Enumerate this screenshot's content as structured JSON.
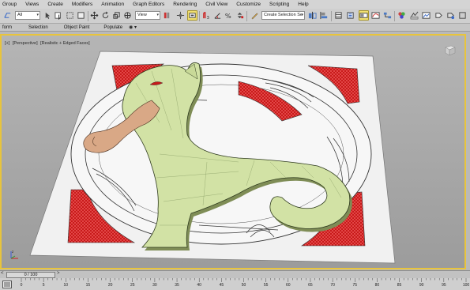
{
  "menubar": {
    "items": [
      "Group",
      "Views",
      "Create",
      "Modifiers",
      "Animation",
      "Graph Editors",
      "Rendering",
      "Civil View",
      "Customize",
      "Scripting",
      "Help"
    ]
  },
  "toolbar": {
    "selection_filter": "All",
    "reference_coord_system": "View",
    "named_selection_placeholder": "Create Selection Se",
    "icons": [
      "undo-icon",
      "selection-filter",
      "select-object-icon",
      "select-by-name-icon",
      "rectangular-selection-icon",
      "window-crossing-icon",
      "select-move-icon",
      "select-rotate-icon",
      "select-scale-icon",
      "select-place-icon",
      "use-pivot-center-icon",
      "select-manipulate-icon",
      "keyboard-shortcut-icon",
      "snaps-toggle-icon",
      "angle-snap-icon",
      "percent-snap-icon",
      "spinner-snap-icon",
      "edit-named-selection-icon",
      "mirror-icon",
      "align-icon",
      "layer-explorer-icon",
      "scene-explorer-icon",
      "graphite-ribbon-icon",
      "curve-editor-icon",
      "schematic-view-icon",
      "material-editor-icon",
      "render-setup-icon",
      "rendered-frame-window-icon",
      "render-production-icon",
      "render-iterative-icon"
    ]
  },
  "ribbon": {
    "tabs": [
      "form",
      "Selection",
      "Object Paint",
      "Populate"
    ],
    "toggle": "◉ ▾"
  },
  "viewport": {
    "label_parts": [
      "[+]",
      "[Perspective]",
      "[Realistic + Edged Faces]"
    ],
    "border_color": "#e8c43c",
    "scene": "3D relief model of a heraldic cat on a red-checked tile",
    "colors": {
      "model_green": "#d2e2a5",
      "tongue": "#d9a886",
      "plate_white": "#f2f2f2",
      "red_check": "#c81a1a",
      "outline": "#3a3a3a"
    }
  },
  "timeline": {
    "frame_indicator": "0 / 100",
    "prev_arrow": "<",
    "next_arrow": ">"
  },
  "trackbar": {
    "ruler_labels": [
      "0",
      "5",
      "10",
      "15",
      "20",
      "25",
      "30",
      "35",
      "40",
      "45",
      "50",
      "55",
      "60",
      "65",
      "70",
      "75",
      "80",
      "85",
      "90",
      "95",
      "100"
    ]
  }
}
